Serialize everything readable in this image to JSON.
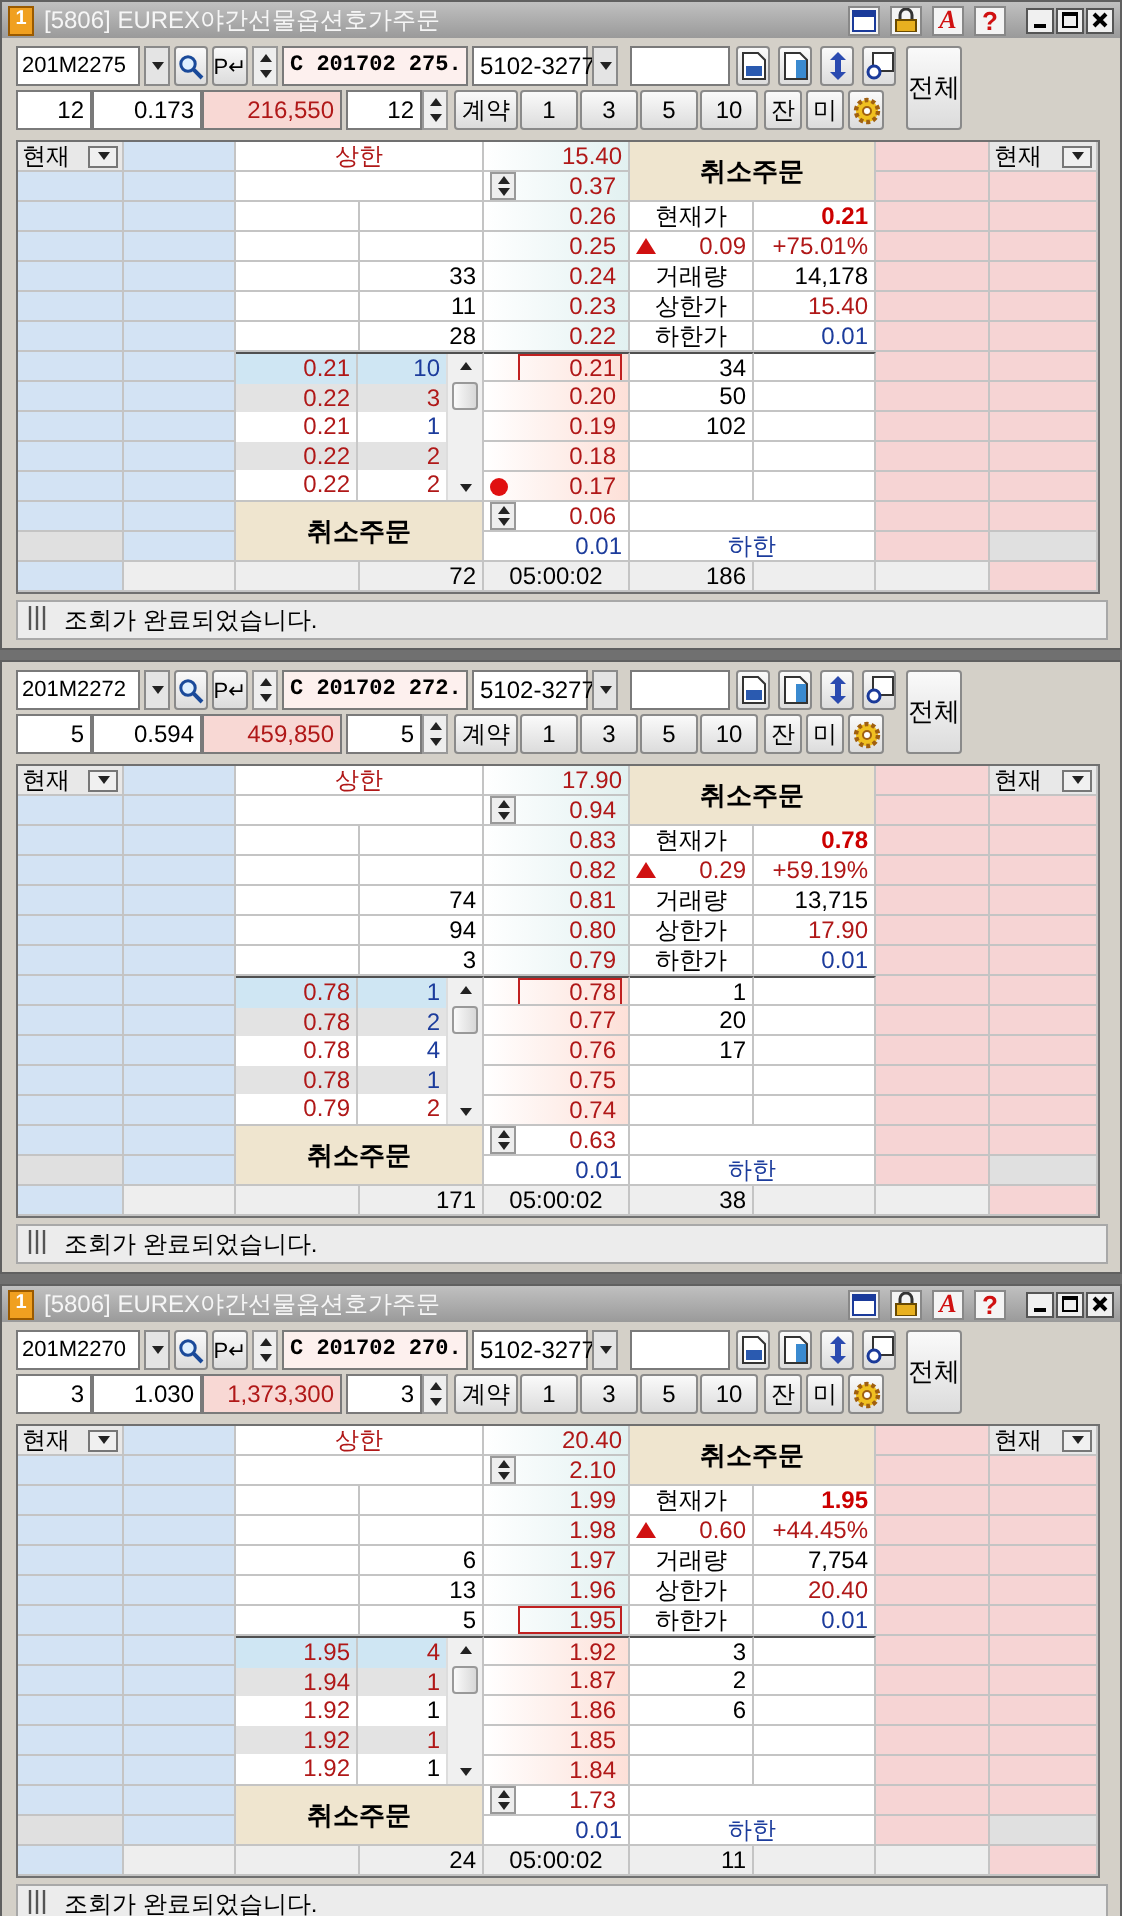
{
  "panels": [
    {
      "title": {
        "app_icon": "1",
        "text": "[5806] EUREX야간선물옵션호가주문",
        "font_button": "A",
        "help_button": "?"
      },
      "toolbar": {
        "code": "201M2275",
        "p_button": "P↵",
        "name": "C 201702 275.",
        "account": "5102-3277",
        "position_qty": "12",
        "avg_price": "0.173",
        "amount": "216,550",
        "order_qty": "12",
        "unit_button": "계약",
        "qty_buttons": [
          "1",
          "3",
          "5",
          "10"
        ],
        "extra_buttons": [
          "잔",
          "미"
        ],
        "all_button": "전체"
      },
      "grid": {
        "left_header": "현재",
        "right_header": "현재",
        "upper_label": "상한",
        "upper_limit": "15.40",
        "top_price": "0.37",
        "cancel_top": "취소주문",
        "asks": [
          {
            "price": "0.26",
            "current": false
          },
          {
            "price": "0.25",
            "current": false
          },
          {
            "price": "0.24",
            "qty": "33",
            "current": false
          },
          {
            "price": "0.23",
            "qty": "11",
            "current": false
          },
          {
            "price": "0.22",
            "qty": "28",
            "current": false
          }
        ],
        "info": [
          {
            "kind": "field",
            "label": "현재가",
            "value": "0.21",
            "color": "#cc0000"
          },
          {
            "kind": "change",
            "rising": true,
            "change": "0.09",
            "rate": "+75.01%"
          },
          {
            "kind": "field",
            "label": "거래량",
            "value": "14,178",
            "color": "#000000"
          },
          {
            "kind": "field",
            "label": "상한가",
            "value": "15.40",
            "color": "#b01818"
          },
          {
            "kind": "field",
            "label": "하한가",
            "value": "0.01",
            "color": "#1c3c9c"
          }
        ],
        "bids": [
          {
            "price": "0.21",
            "qty": "34",
            "current": true,
            "marked": false
          },
          {
            "price": "0.20",
            "qty": "50",
            "current": false,
            "marked": false
          },
          {
            "price": "0.19",
            "qty": "102",
            "current": false,
            "marked": false
          },
          {
            "price": "0.18",
            "current": false,
            "marked": false
          },
          {
            "price": "0.17",
            "current": false,
            "marked": true
          }
        ],
        "orders": [
          {
            "price": "0.21",
            "qty": "10",
            "color": "#1c3c9c",
            "selected": true
          },
          {
            "price": "0.22",
            "qty": "3",
            "color": "#b01818",
            "selected": false
          },
          {
            "price": "0.21",
            "qty": "1",
            "color": "#1c3c9c",
            "selected": false
          },
          {
            "price": "0.22",
            "qty": "2",
            "color": "#b01818",
            "selected": false
          },
          {
            "price": "0.22",
            "qty": "2",
            "color": "#b01818",
            "selected": false
          }
        ],
        "cancel_bottom": "취소주문",
        "bottom_price": "0.06",
        "lower_limit": "0.01",
        "lower_label": "하한",
        "total_ask": "72",
        "time": "05:00:02",
        "total_bid": "186"
      },
      "status": "조회가 완료되었습니다."
    },
    {
      "toolbar": {
        "code": "201M2272",
        "p_button": "P↵",
        "name": "C 201702 272.",
        "account": "5102-3277",
        "position_qty": "5",
        "avg_price": "0.594",
        "amount": "459,850",
        "order_qty": "5",
        "unit_button": "계약",
        "qty_buttons": [
          "1",
          "3",
          "5",
          "10"
        ],
        "extra_buttons": [
          "잔",
          "미"
        ],
        "all_button": "전체"
      },
      "grid": {
        "left_header": "현재",
        "right_header": "현재",
        "upper_label": "상한",
        "upper_limit": "17.90",
        "top_price": "0.94",
        "cancel_top": "취소주문",
        "asks": [
          {
            "price": "0.83",
            "current": false
          },
          {
            "price": "0.82",
            "current": false
          },
          {
            "price": "0.81",
            "qty": "74",
            "current": false
          },
          {
            "price": "0.80",
            "qty": "94",
            "current": false
          },
          {
            "price": "0.79",
            "qty": "3",
            "current": false
          }
        ],
        "info": [
          {
            "kind": "field",
            "label": "현재가",
            "value": "0.78",
            "color": "#cc0000"
          },
          {
            "kind": "change",
            "rising": true,
            "change": "0.29",
            "rate": "+59.19%"
          },
          {
            "kind": "field",
            "label": "거래량",
            "value": "13,715",
            "color": "#000000"
          },
          {
            "kind": "field",
            "label": "상한가",
            "value": "17.90",
            "color": "#b01818"
          },
          {
            "kind": "field",
            "label": "하한가",
            "value": "0.01",
            "color": "#1c3c9c"
          }
        ],
        "bids": [
          {
            "price": "0.78",
            "qty": "1",
            "current": true,
            "marked": false
          },
          {
            "price": "0.77",
            "qty": "20",
            "current": false,
            "marked": false
          },
          {
            "price": "0.76",
            "qty": "17",
            "current": false,
            "marked": false
          },
          {
            "price": "0.75",
            "current": false,
            "marked": false
          },
          {
            "price": "0.74",
            "current": false,
            "marked": false
          }
        ],
        "orders": [
          {
            "price": "0.78",
            "qty": "1",
            "color": "#1c3c9c",
            "selected": true
          },
          {
            "price": "0.78",
            "qty": "2",
            "color": "#1c3c9c",
            "selected": false
          },
          {
            "price": "0.78",
            "qty": "4",
            "color": "#1c3c9c",
            "selected": false
          },
          {
            "price": "0.78",
            "qty": "1",
            "color": "#1c3c9c",
            "selected": false
          },
          {
            "price": "0.79",
            "qty": "2",
            "color": "#b01818",
            "selected": false
          }
        ],
        "cancel_bottom": "취소주문",
        "bottom_price": "0.63",
        "lower_limit": "0.01",
        "lower_label": "하한",
        "total_ask": "171",
        "time": "05:00:02",
        "total_bid": "38"
      },
      "status": "조회가 완료되었습니다."
    },
    {
      "title": {
        "app_icon": "1",
        "text": "[5806] EUREX야간선물옵션호가주문",
        "font_button": "A",
        "help_button": "?"
      },
      "toolbar": {
        "code": "201M2270",
        "p_button": "P↵",
        "name": "C 201702 270.",
        "account": "5102-3277",
        "position_qty": "3",
        "avg_price": "1.030",
        "amount": "1,373,300",
        "order_qty": "3",
        "unit_button": "계약",
        "qty_buttons": [
          "1",
          "3",
          "5",
          "10"
        ],
        "extra_buttons": [
          "잔",
          "미"
        ],
        "all_button": "전체"
      },
      "grid": {
        "left_header": "현재",
        "right_header": "현재",
        "upper_label": "상한",
        "upper_limit": "20.40",
        "top_price": "2.10",
        "cancel_top": "취소주문",
        "asks": [
          {
            "price": "1.99",
            "current": false
          },
          {
            "price": "1.98",
            "current": false
          },
          {
            "price": "1.97",
            "qty": "6",
            "current": false
          },
          {
            "price": "1.96",
            "qty": "13",
            "current": false
          },
          {
            "price": "1.95",
            "qty": "5",
            "current": true
          }
        ],
        "info": [
          {
            "kind": "field",
            "label": "현재가",
            "value": "1.95",
            "color": "#cc0000"
          },
          {
            "kind": "change",
            "rising": true,
            "change": "0.60",
            "rate": "+44.45%"
          },
          {
            "kind": "field",
            "label": "거래량",
            "value": "7,754",
            "color": "#000000"
          },
          {
            "kind": "field",
            "label": "상한가",
            "value": "20.40",
            "color": "#b01818"
          },
          {
            "kind": "field",
            "label": "하한가",
            "value": "0.01",
            "color": "#1c3c9c"
          }
        ],
        "bids": [
          {
            "price": "1.92",
            "qty": "3",
            "current": false,
            "marked": false
          },
          {
            "price": "1.87",
            "qty": "2",
            "current": false,
            "marked": false
          },
          {
            "price": "1.86",
            "qty": "6",
            "current": false,
            "marked": false
          },
          {
            "price": "1.85",
            "current": false,
            "marked": false
          },
          {
            "price": "1.84",
            "current": false,
            "marked": false
          }
        ],
        "orders": [
          {
            "price": "1.95",
            "qty": "4",
            "color": "#b01818",
            "selected": true
          },
          {
            "price": "1.94",
            "qty": "1",
            "color": "#b01818",
            "selected": false
          },
          {
            "price": "1.92",
            "qty": "1",
            "color": "#000000",
            "selected": false
          },
          {
            "price": "1.92",
            "qty": "1",
            "color": "#b01818",
            "selected": false
          },
          {
            "price": "1.92",
            "qty": "1",
            "color": "#000000",
            "selected": false
          }
        ],
        "cancel_bottom": "취소주문",
        "bottom_price": "1.73",
        "lower_limit": "0.01",
        "lower_label": "하한",
        "total_ask": "24",
        "time": "05:00:02",
        "total_bid": "11"
      },
      "status": "조회가 완료되었습니다."
    }
  ]
}
